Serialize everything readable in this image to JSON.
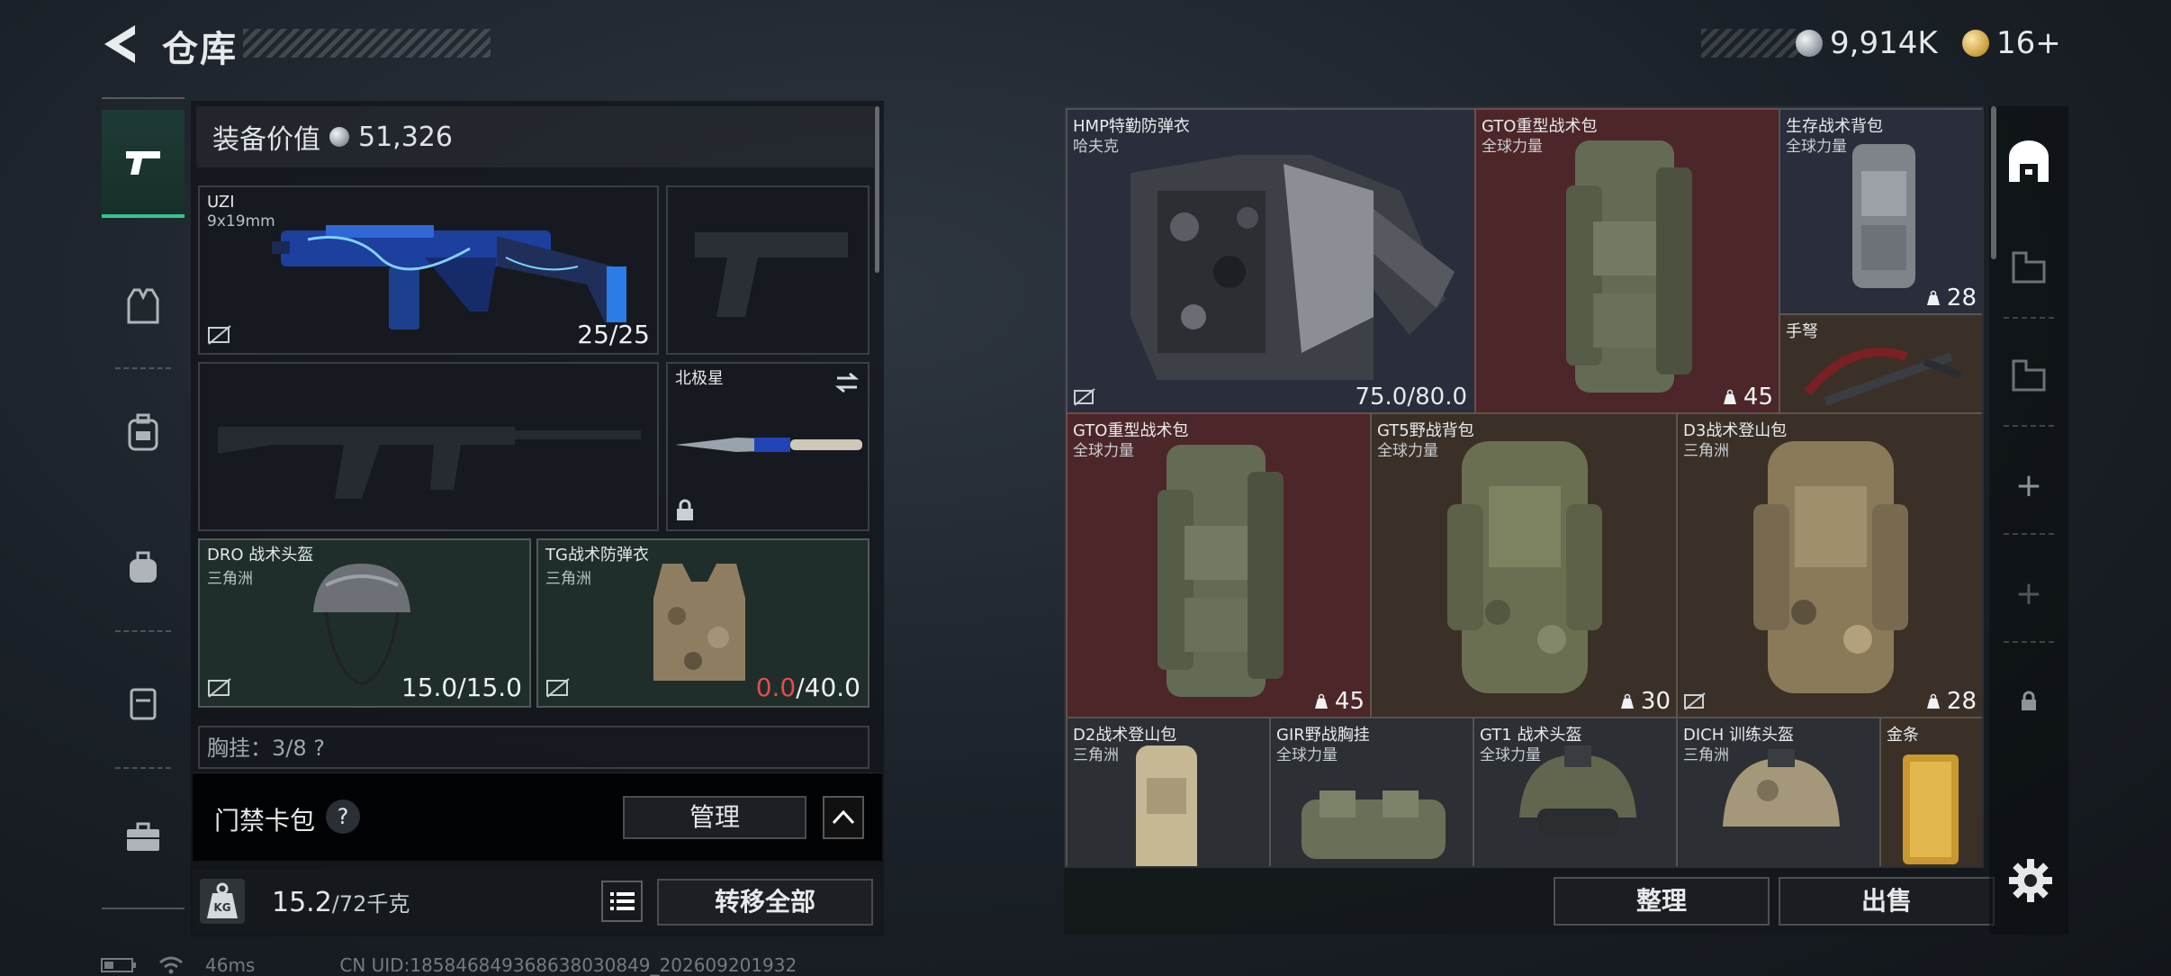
{
  "header": {
    "title": "仓库",
    "currency_silver": "9,914K",
    "currency_gold": "16+"
  },
  "left_rail": {
    "items": [
      {
        "icon": "pistol-icon",
        "active": true
      },
      {
        "icon": "armor-vest-icon",
        "active": false
      },
      {
        "icon": "backpack-icon",
        "active": false
      },
      {
        "icon": "bag-icon",
        "active": false
      },
      {
        "icon": "case-icon",
        "active": false
      },
      {
        "icon": "toolbox-icon",
        "active": false
      }
    ]
  },
  "equipment": {
    "value_label": "装备价值",
    "value": "51,326",
    "primary_weapon": {
      "name": "UZI",
      "ammo_type": "9x19mm",
      "ammo": "25/25"
    },
    "melee": {
      "name": "北极星"
    },
    "helmet": {
      "name": "DRO 战术头盔",
      "faction": "三角洲",
      "durability": "15.0/15.0"
    },
    "armor": {
      "name": "TG战术防弹衣",
      "faction": "三角洲",
      "durability_current": "0.0",
      "durability_max": "/40.0"
    },
    "partial_label": "胸挂：3/8 ?"
  },
  "gate_card": {
    "label": "门禁卡包",
    "help": "?",
    "manage": "管理"
  },
  "weight": {
    "current": "15.2",
    "max": "/72千克"
  },
  "transfer_all": "转移全部",
  "status": {
    "ping": "46ms",
    "uid": "CN UID:185846849368638030849_202609201932"
  },
  "stash": {
    "items": [
      {
        "name": "HMP特勤防弹衣",
        "sub": "哈夫克",
        "durability": "75.0/80.0",
        "bg": "blue"
      },
      {
        "name": "GTO重型战术包",
        "sub": "全球力量",
        "count": "45",
        "bg": "red"
      },
      {
        "name": "生存战术背包",
        "sub": "全球力量",
        "count": "28",
        "bg": "blue"
      },
      {
        "name": "手弩",
        "sub": "",
        "count": "",
        "bg": "brown"
      },
      {
        "name": "GTO重型战术包",
        "sub": "全球力量",
        "count": "45",
        "bg": "red"
      },
      {
        "name": "GT5野战背包",
        "sub": "全球力量",
        "count": "30",
        "bg": "brown"
      },
      {
        "name": "D3战术登山包",
        "sub": "三角洲",
        "count": "28",
        "bg": "brown"
      },
      {
        "name": "D2战术登山包",
        "sub": "三角洲",
        "bg": "gray"
      },
      {
        "name": "GIR野战胸挂",
        "sub": "全球力量",
        "bg": "gray"
      },
      {
        "name": "GT1 战术头盔",
        "sub": "全球力量",
        "bg": "gray"
      },
      {
        "name": "DICH 训练头盔",
        "sub": "三角洲",
        "bg": "gray"
      },
      {
        "name": "金条",
        "sub": "",
        "bg": "brown"
      }
    ]
  },
  "stash_actions": {
    "sort": "整理",
    "sell": "出售"
  },
  "right_rail": {
    "tabs": [
      {
        "icon": "stash-home-icon",
        "active": true
      },
      {
        "icon": "storage-tab-icon"
      },
      {
        "icon": "storage-tab-icon"
      },
      {
        "icon": "plus-icon",
        "label": "+"
      },
      {
        "icon": "plus-icon",
        "label": "+"
      },
      {
        "icon": "lock-icon"
      }
    ]
  },
  "colors": {
    "accent_green": "#37c48f",
    "rarity_red": "#4d2629",
    "rarity_blue": "#2a2d3b",
    "rarity_gold": "#3b3027",
    "warning_red": "#e04e4e"
  }
}
